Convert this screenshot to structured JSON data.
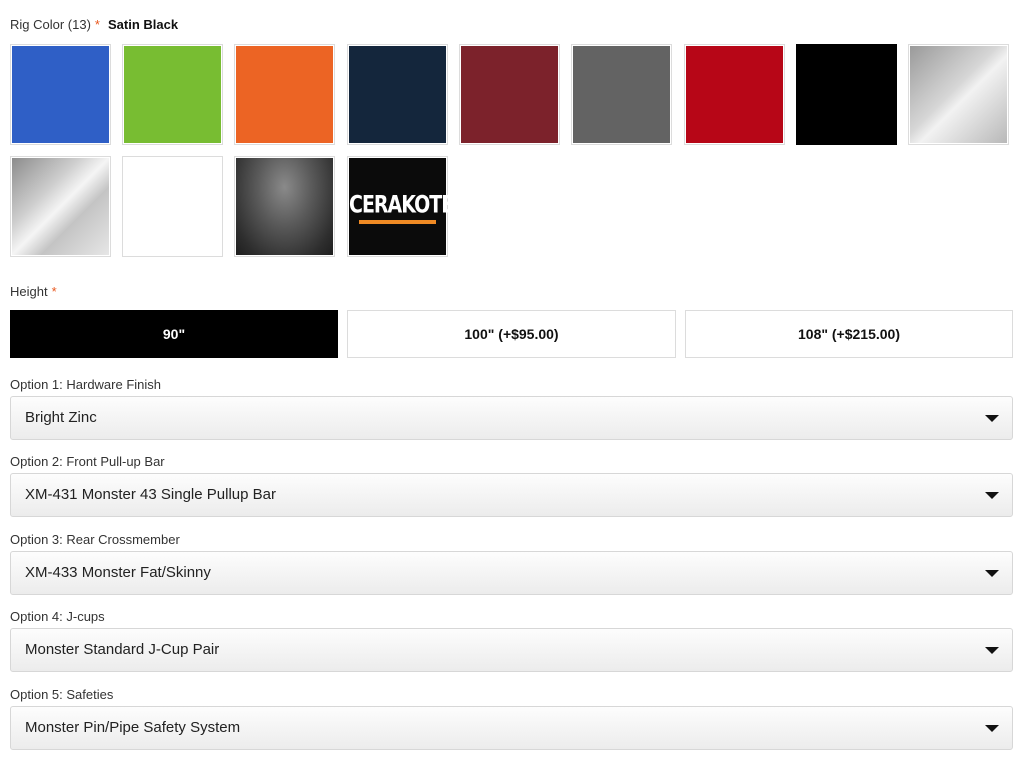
{
  "rig_color": {
    "label": "Rig Color (13)",
    "required": "*",
    "selected": "Satin Black",
    "swatches": [
      {
        "name": "blue",
        "color": "#2f5fc6"
      },
      {
        "name": "green",
        "color": "#78bd32"
      },
      {
        "name": "orange",
        "color": "#ec6424"
      },
      {
        "name": "navy",
        "color": "#14263c"
      },
      {
        "name": "maroon",
        "color": "#7c222b"
      },
      {
        "name": "gray",
        "color": "#636363"
      },
      {
        "name": "red",
        "color": "#b70617"
      },
      {
        "name": "satin-black",
        "color": "#000000"
      },
      {
        "name": "silver",
        "color": "#c8c8c8"
      },
      {
        "name": "chrome",
        "color": "#bdbdbd"
      },
      {
        "name": "white",
        "color": "#ffffff"
      },
      {
        "name": "textured-black",
        "color": "#4a4a4a"
      },
      {
        "name": "cerakote",
        "color": "#0b0b0b",
        "logo_text": "CERAKOTE",
        "logo_accent": "#f08a24"
      }
    ]
  },
  "height": {
    "label": "Height",
    "required": "*",
    "options": [
      "90\"",
      "100\" (+$95.00)",
      "108\" (+$215.00)"
    ],
    "selected_index": 0
  },
  "options": [
    {
      "label": "Option 1: Hardware Finish",
      "value": "Bright Zinc"
    },
    {
      "label": "Option 2: Front Pull-up Bar",
      "value": "XM-431 Monster 43 Single Pullup Bar"
    },
    {
      "label": "Option 3: Rear Crossmember",
      "value": "XM-433 Monster Fat/Skinny"
    },
    {
      "label": "Option 4: J-cups",
      "value": "Monster Standard J-Cup Pair"
    },
    {
      "label": "Option 5: Safeties",
      "value": "Monster Pin/Pipe Safety System"
    }
  ]
}
